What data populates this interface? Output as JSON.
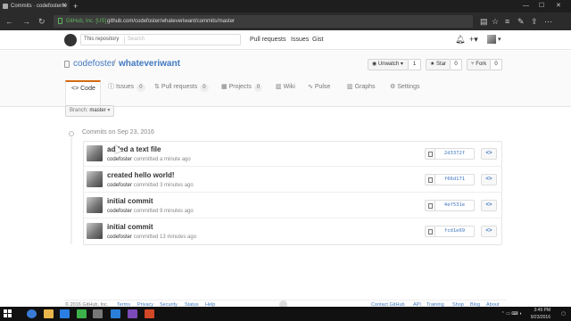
{
  "browser": {
    "tab_title": "Commits · codefoster/w",
    "new_tab": "+",
    "secure_label": "GitHub, Inc. [US]",
    "url": "github.com/codefoster/whateveriwant/commits/master"
  },
  "github": {
    "search_scope": "This repository",
    "search_placeholder": "Search",
    "nav": {
      "pull_requests": "Pull requests",
      "issues": "Issues",
      "gist": "Gist"
    }
  },
  "repo": {
    "owner": "codefoster",
    "slash": "/",
    "name": "whateveriwant",
    "unwatch_label": "Unwatch",
    "unwatch_count": "1",
    "star_label": "Star",
    "star_count": "0",
    "fork_label": "Fork",
    "fork_count": "0"
  },
  "tabs": [
    {
      "label": "Code"
    },
    {
      "label": "Issues",
      "count": "0"
    },
    {
      "label": "Pull requests",
      "count": "0"
    },
    {
      "label": "Projects",
      "count": "0"
    },
    {
      "label": "Wiki"
    },
    {
      "label": "Pulse"
    },
    {
      "label": "Graphs"
    },
    {
      "label": "Settings"
    }
  ],
  "branch": {
    "prefix": "Branch:",
    "name": "master"
  },
  "commits": {
    "header": "Commits on Sep 23, 2016",
    "items": [
      {
        "title": "added a text file",
        "author": "codefoster",
        "meta": "committed a minute ago",
        "sha": "2d3372f"
      },
      {
        "title": "created hello world!",
        "author": "codefoster",
        "meta": "committed 3 minutes ago",
        "sha": "f66d171"
      },
      {
        "title": "initial commit",
        "author": "codefoster",
        "meta": "committed 9 minutes ago",
        "sha": "4ef531e"
      },
      {
        "title": "initial commit",
        "author": "codefoster",
        "meta": "committed 13 minutes ago",
        "sha": "fcd1e69"
      }
    ]
  },
  "footer": {
    "copyright": "© 2016 GitHub, Inc.",
    "left_links": [
      "Terms",
      "Privacy",
      "Security",
      "Status",
      "Help"
    ],
    "right_links": [
      "Contact GitHub",
      "API",
      "Training",
      "Shop",
      "Blog",
      "About"
    ]
  },
  "taskbar": {
    "time": "3:49 PM",
    "date": "9/23/2016"
  },
  "colors": {
    "accent_link": "#4078c0",
    "tab_active_border": "#d26911",
    "chrome_dark": "#2b2b2b",
    "taskbar": "#111111"
  }
}
